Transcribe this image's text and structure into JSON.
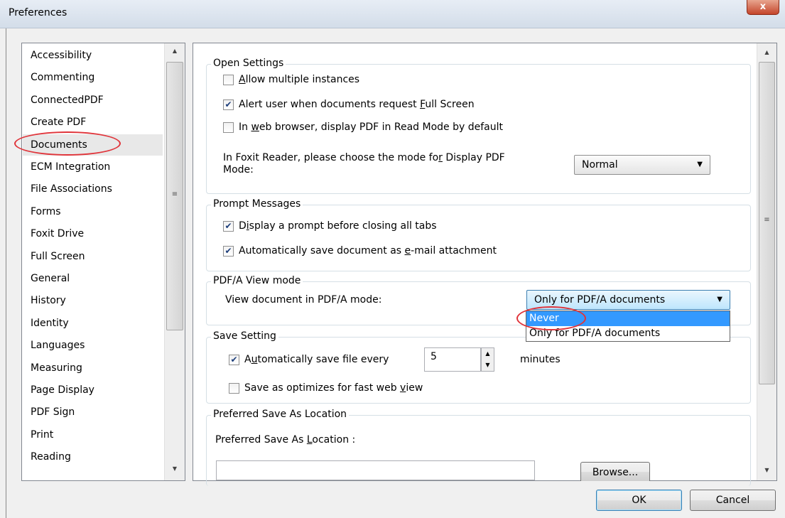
{
  "window": {
    "title": "Preferences",
    "close_label": "x"
  },
  "categories": [
    "Accessibility",
    "Commenting",
    "ConnectedPDF",
    "Create PDF",
    "Documents",
    "ECM Integration",
    "File Associations",
    "Forms",
    "Foxit Drive",
    "Full Screen",
    "General",
    "History",
    "Identity",
    "Languages",
    "Measuring",
    "Page Display",
    "PDF Sign",
    "Print",
    "Reading"
  ],
  "selected_category": "Documents",
  "open_settings": {
    "legend": "Open Settings",
    "allow_multiple": {
      "pre": "",
      "u": "A",
      "post": "llow multiple instances",
      "checked": false
    },
    "alert_fullscreen": {
      "pre": "Alert user when documents request ",
      "u": "F",
      "post": "ull Screen",
      "checked": true
    },
    "web_browser": {
      "pre": "In ",
      "u": "w",
      "post": "eb browser, display PDF in Read Mode by default",
      "checked": false
    },
    "display_mode_line1_pre": "In Foxit Reader, please choose the mode fo",
    "display_mode_line1_u": "r",
    "display_mode_line1_post": " Display PDF",
    "display_mode_line2": "Mode:",
    "display_mode_value": "Normal"
  },
  "prompt_messages": {
    "legend": "Prompt Messages",
    "display_prompt": {
      "pre": "D",
      "u": "i",
      "post": "splay a prompt before closing all tabs",
      "checked": true
    },
    "auto_save_attach": {
      "pre": "Automatically save document as ",
      "u": "e",
      "post": "-mail attachment",
      "checked": true
    }
  },
  "pdfa": {
    "legend": "PDF/A View mode",
    "label": "View document in PDF/A mode:",
    "value": "Only for PDF/A documents",
    "options": [
      "Never",
      "Only for PDF/A documents"
    ],
    "highlighted_option": "Never"
  },
  "save_setting": {
    "legend": "Save Setting",
    "auto_save": {
      "pre": "A",
      "u": "u",
      "post": "tomatically save file every",
      "checked": true
    },
    "minutes_value": "5",
    "minutes_label": "minutes",
    "optimize": {
      "pre": "Save as optimizes for fast web ",
      "u": "v",
      "post": "iew",
      "checked": false
    }
  },
  "save_location": {
    "legend": "Preferred Save As Location",
    "label_pre": "Preferred Save As ",
    "label_u": "L",
    "label_post": "ocation :",
    "path_value": "",
    "browse_label": "Browse..."
  },
  "buttons": {
    "ok": "OK",
    "cancel": "Cancel"
  },
  "annotation_color": "#e0343a"
}
